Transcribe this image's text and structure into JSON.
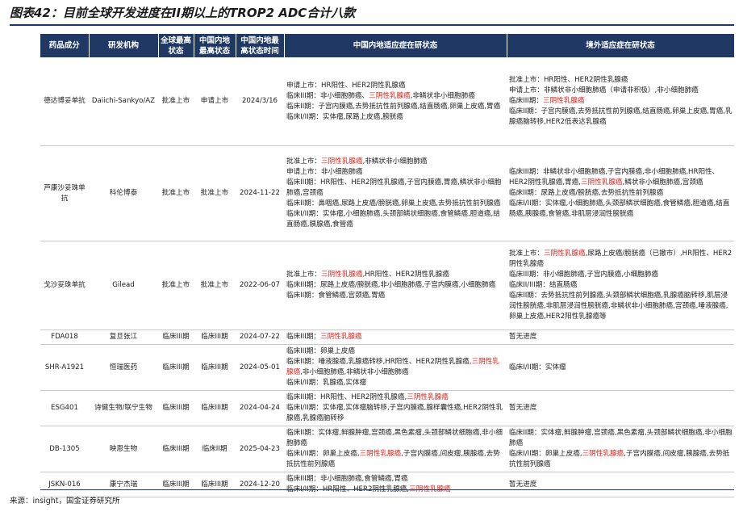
{
  "title": "图表42：目前全球开发进度在II期以上的TROP2 ADC合计八款",
  "headers": [
    "药品成分",
    "研发机构",
    "全球最高状态",
    "中国内地最高状态",
    "中国内地最高状态时间",
    "中国内地适应症在研状态",
    "境外适应症在研状态"
  ],
  "rows": [
    {
      "drug": "德达博妥单抗",
      "org": "Daiichi-Sankyo/AZ",
      "global": "批准上市",
      "china": "申请上市",
      "date": "2024/3/16",
      "china_status": [
        [
          {
            "t": "申请上市：HR阳性、HER2阴性乳腺癌"
          }
        ],
        [
          {
            "t": "临床III期：非小细胞肺癌、"
          },
          {
            "t": "三阴性乳腺癌",
            "r": true
          },
          {
            "t": ",非鳞状非小细胞肺癌"
          }
        ],
        [
          {
            "t": "临床II期：子宫内膜癌,去势抵抗性前列腺癌,结直肠癌,卵巢上皮癌,胃癌"
          }
        ],
        [
          {
            "t": "临床I/II期：实体瘤,尿路上皮癌,膀胱癌"
          }
        ]
      ],
      "abroad_status": [
        [
          {
            "t": "批准上市：HR阳性、HER2阴性乳腺癌"
          }
        ],
        [
          {
            "t": "申请上市：非鳞状非小细胞肺癌（申请非积极）,非小细胞肺癌"
          }
        ],
        [
          {
            "t": "临床III期："
          },
          {
            "t": "三阴性乳腺癌",
            "r": true
          }
        ],
        [
          {
            "t": "临床II期：子宫内膜癌,去势抵抗性前列腺癌,结直肠癌,卵巢上皮癌,胃癌,乳腺癌脑转移,HER2低表达乳腺癌"
          }
        ]
      ]
    },
    {
      "drug": "芦康沙妥珠单抗",
      "org": "科伦博泰",
      "global": "批准上市",
      "china": "批准上市",
      "date": "2024-11-22",
      "china_status": [
        [
          {
            "t": "批准上市："
          },
          {
            "t": "三阴性乳腺癌",
            "r": true
          },
          {
            "t": ",非鳞状非小细胞肺癌"
          }
        ],
        [
          {
            "t": "申请上市：非小细胞肺癌"
          }
        ],
        [
          {
            "t": "临床III期：HR阳性、HER2阴性乳腺癌,子宫内膜癌,胃癌,鳞状非小细胞肺癌,宫颈癌"
          }
        ],
        [
          {
            "t": "临床II期：鼻咽癌,尿路上皮癌/膀胱癌,卵巢上皮癌,去势抵抗性前列腺癌"
          }
        ],
        [
          {
            "t": "临床I/II期：实体瘤,小细胞肺癌,头颈部鳞状细胞癌,食管鳞癌,胆道癌,结直肠癌,胰腺癌,食管癌"
          }
        ]
      ],
      "abroad_status": [
        [
          {
            "t": "临床III期：非鳞状非小细胞肺癌,子宫内膜癌,非小细胞肺癌,HR阳性、HER2阴性乳腺癌,胃癌,"
          },
          {
            "t": "三阴性乳腺癌",
            "r": true
          },
          {
            "t": ",鳞状非小细胞肺癌,宫颈癌"
          }
        ],
        [
          {
            "t": "临床II期：尿路上皮癌/膀胱癌,去势抵抗性前列腺癌"
          }
        ],
        [
          {
            "t": "临床I/II期：实体瘤,小细胞肺癌,头颈部鳞状细胞癌,食管鳞癌,胆道癌,结直肠癌,胰腺癌,食管癌,非肌层浸润性膀胱癌"
          }
        ]
      ]
    },
    {
      "drug": "戈沙妥珠单抗",
      "org": "Gilead",
      "global": "批准上市",
      "china": "批准上市",
      "date": "2022-06-07",
      "china_status": [
        [
          {
            "t": "批准上市："
          },
          {
            "t": "三阴性乳腺癌",
            "r": true
          },
          {
            "t": ",HR阳性、HER2阴性乳腺癌"
          }
        ],
        [
          {
            "t": "临床III期：尿路上皮癌/膀胱癌,非小细胞肺癌,子宫内膜癌,小细胞肺癌"
          }
        ],
        [
          {
            "t": "临床II期：食管鳞癌,宫颈癌,胃癌"
          }
        ]
      ],
      "abroad_status": [
        [
          {
            "t": "批准上市："
          },
          {
            "t": "三阴性乳腺癌",
            "r": true
          },
          {
            "t": ",尿路上皮癌/膀胱癌（已撤市）,HR阳性、HER2阴性乳腺癌"
          }
        ],
        [
          {
            "t": "临床III期：非小细胞肺癌,子宫内膜癌,小细胞肺癌"
          }
        ],
        [
          {
            "t": "临床II/III期：结直肠癌"
          }
        ],
        [
          {
            "t": "临床II期：去势抵抗性前列腺癌,头颈部鳞状细胞癌,乳腺癌脑转移,肌层浸润性膀胱癌,非肌层浸润性膀胱癌,非鳞状非小细胞肺癌,宫颈癌,唾液腺癌,卵巢上皮癌,HER2阳性乳腺癌等"
          }
        ]
      ]
    },
    {
      "drug": "FDA018",
      "org": "复旦张江",
      "global": "临床III期",
      "china": "临床III期",
      "date": "2024-07-22",
      "china_status": [
        [
          {
            "t": "临床III期："
          },
          {
            "t": "三阴性乳腺癌",
            "r": true
          }
        ]
      ],
      "abroad_status": [
        [
          {
            "t": "暂无进度"
          }
        ]
      ]
    },
    {
      "drug": "SHR-A1921",
      "org": "恒瑞医药",
      "global": "临床III期",
      "china": "临床III期",
      "date": "2024-05-01",
      "china_status": [
        [
          {
            "t": "临床III期：卵巢上皮癌"
          }
        ],
        [
          {
            "t": "临床II期：唾液腺癌,乳腺癌转移,HR阳性、HER2阴性乳腺癌,"
          },
          {
            "t": "三阴性乳腺癌",
            "r": true
          },
          {
            "t": ",非小细胞肺癌,非鳞状非小细胞肺癌"
          }
        ],
        [
          {
            "t": "临床I/II期：乳腺癌,实体瘤"
          }
        ]
      ],
      "abroad_status": [
        [
          {
            "t": "临床I/II期：实体瘤"
          }
        ]
      ]
    },
    {
      "drug": "ESG401",
      "org": "诗健生物/联宁生物",
      "global": "临床III期",
      "china": "临床III期",
      "date": "2024-04-24",
      "china_status": [
        [
          {
            "t": "临床III期：HR阳性、HER2阴性乳腺癌,"
          },
          {
            "t": "三阴性乳腺癌",
            "r": true
          }
        ],
        [
          {
            "t": "临床I/II期：实体瘤,实体瘤脑转移,子宫内膜癌,腺样囊性癌,HER2阴性乳腺癌,乳腺癌脑转移"
          }
        ]
      ],
      "abroad_status": [
        [
          {
            "t": "暂无进度"
          }
        ]
      ]
    },
    {
      "drug": "DB-1305",
      "org": "映恩生物",
      "global": "临床III期",
      "china": "临床II期",
      "date": "2025-04-23",
      "china_status": [
        [
          {
            "t": "临床II期：实体瘤,鲜腺肿瘤,宫颈癌,黑色素瘤,头颈部鳞状细胞癌,非小细胞肺癌"
          }
        ],
        [
          {
            "t": "临床I/II期：卵巢上皮癌,"
          },
          {
            "t": "三阴性乳腺癌",
            "r": true
          },
          {
            "t": ",子宫内膜癌,间皮瘤,胰腺癌,去势抵抗性前列腺癌"
          }
        ]
      ],
      "abroad_status": [
        [
          {
            "t": "临床II期：实体瘤,鲜腺肿瘤,宫颈癌,黑色素瘤,头颈部鳞状细胞癌,非小细胞肺癌"
          }
        ],
        [
          {
            "t": "临床I/II期：卵巢上皮癌,"
          },
          {
            "t": "三阴性乳腺癌",
            "r": true
          },
          {
            "t": ",子宫内膜癌,间皮瘤,胰腺癌,去势抵抗性前列腺癌"
          }
        ]
      ]
    },
    {
      "drug": "JSKN-016",
      "org": "康宁杰瑞",
      "global": "临床III期",
      "china": "临床III期",
      "date": "2024-12-20",
      "china_status": [
        [
          {
            "t": "临床III期：非小细胞肺癌,食管鳞癌,胃癌"
          }
        ],
        [
          {
            "t": "临床I/II期：HR阳性、HER2阴性乳腺癌,"
          },
          {
            "t": "三阴性乳腺癌",
            "r": true
          }
        ]
      ],
      "abroad_status": [
        [
          {
            "t": "暂无进度"
          }
        ]
      ]
    }
  ],
  "source": "来源：insight，国金证券研究所"
}
